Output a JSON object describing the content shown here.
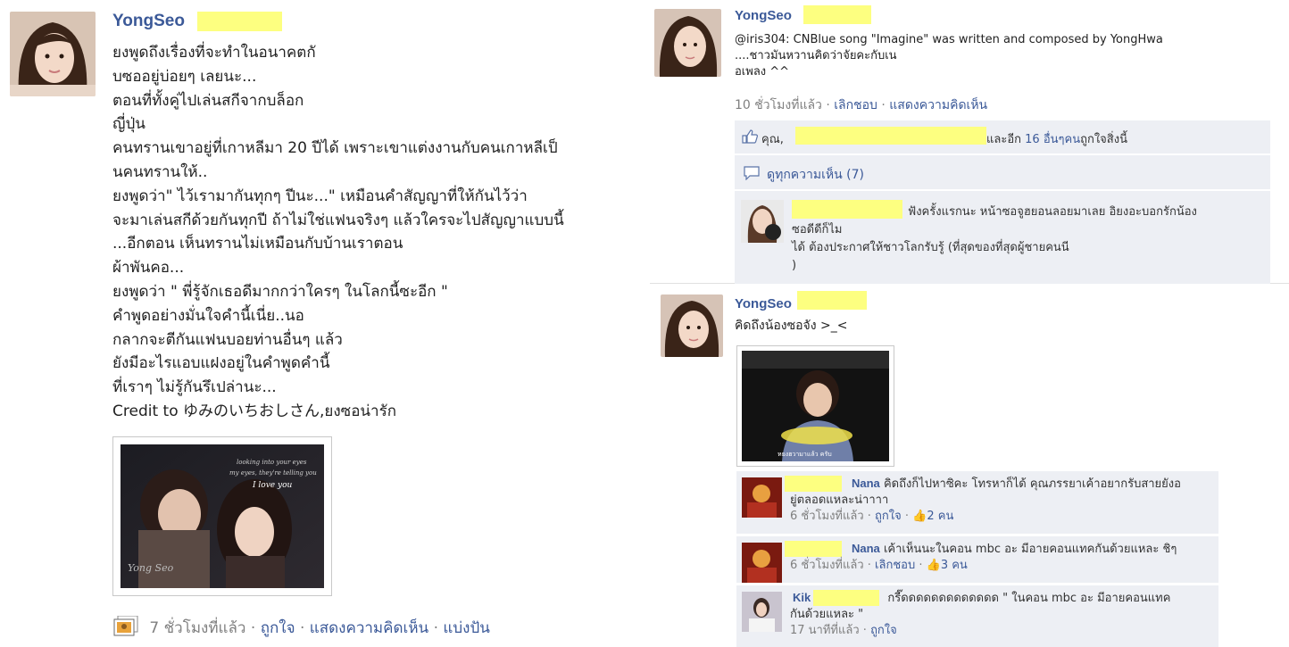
{
  "colors": {
    "link": "#3b5998",
    "highlight": "#fdff80",
    "comment_bg": "#edeff4",
    "meta": "#7f7f7f"
  },
  "post1": {
    "author": "YongSeo",
    "lines": [
      "ยงพูดถึงเรื่องที่จะทำในอนาคตกั",
      "บซออยู่บ่อยๆ เลยนะ...",
      "ตอนที่ทั้งคู่ไปเล่นสกีจากบล็อก",
      "ญี่ปุ่น",
      "คนทรานเขาอยู่ที่เกาหลีมา 20 ปีได้ เพราะเขาแต่งงานกับคนเกาหลีเป็",
      "นคนทรานให้..",
      "ยงพูดว่า\" ไว้เรามากันทุกๆ ปีนะ...\" เหมือนคำสัญญาที่ให้กันไว้ว่า",
      "จะมาเล่นสกีด้วยกันทุกปี ถ้าไม่ใช่แฟนจริงๆ แล้วใครจะไปสัญญาแบบนี้",
      "...อีกตอน เห็นทรานไม่เหมือนกับบ้านเราตอน",
      "ผ้าพันคอ...",
      "ยงพูดว่า \" พี่รู้จักเธอดีมากกว่าใครๆ ในโลกนี้ซะอีก \"",
      "คำพูดอย่างมั่นใจคำนี้เนี่ย..นอ",
      "กลากจะตีกันแฟนบอยท่านอื่นๆ แล้ว",
      "ยังมีอะไรแอบแฝงอยู่ในคำพูดคำนี้",
      "ที่เราๆ ไม่รู้กันรึเปล่านะ...",
      "Credit to ゆみのいちおしさん,ยงซอน่ารัก"
    ],
    "photo_overlay": [
      "looking into your eyes",
      "my eyes, they're telling you",
      "I love you"
    ],
    "photo_watermark": "Yong Seo",
    "footer": {
      "time": "7 ชั่วโมงที่แล้ว",
      "like": "ถูกใจ",
      "comment": "แสดงความคิดเห็น",
      "share": "แบ่งปัน",
      "separator": " · "
    }
  },
  "post2": {
    "author": "YongSeo",
    "lines": [
      "@iris304: CNBlue song \"Imagine\" was written and composed by YongHwa",
      "....ชาวมันหวานคิดว่าจัยคะกับเน",
      "อเพลง ^^"
    ],
    "time": "10 ชั่วโมงที่แล้ว",
    "unlike": "เลิกชอบ",
    "comment": "แสดงความคิดเห็น",
    "likes_prefix": "คุณ,",
    "likes_and": "และอีก",
    "likes_others": "16 อื่นๆคน",
    "likes_suffix": "ถูกใจสิ่งนี้",
    "view_all": "ดูทุกความเห็น (7)",
    "comment_lines": [
      "ฟังครั้งแรกนะ หน้าซอจูฮยอนลอยมาเลย อิยงอะบอกรักน้อง",
      "ซอดีดีก็ไม",
      "ได้ ต้องประกาศให้ชาวโลกรับรู้ (ที่สุดของที่สุดผู้ชายคนนี",
      ")"
    ]
  },
  "post3": {
    "author": "YongSeo",
    "text": "คิดถึงน้องซอจัง >_<",
    "photo_caption": "หยงฮวามาแล้ว ครับ",
    "comments": [
      {
        "author": "Nana",
        "text": "คิดถึงก็ไปหาซิคะ โทรหาก็ได้ คุณภรรยาเค้าอยากรับสายยังอ",
        "text2": "ยู่ตลอดแหละน่าาาา",
        "time": "6 ชั่วโมงที่แล้ว",
        "action": "ถูกใจ",
        "likes": "2 คน"
      },
      {
        "author": "Nana",
        "text": "เค้าเห็นนะในคอน mbc อะ มีอายคอนแทคกันด้วยแหละ ชิๆ",
        "text2": "",
        "time": "6 ชั่วโมงที่แล้ว",
        "action": "เลิกชอบ",
        "likes": "3 คน"
      },
      {
        "author": "Kik",
        "text": "กรี๊ดดดดดดดดดดดดด \" ในคอน mbc อะ มีอายคอนแทค",
        "text2": "กันด้วยแหละ \"",
        "time": "17 นาทีที่แล้ว",
        "action": "ถูกใจ",
        "likes": ""
      }
    ]
  }
}
